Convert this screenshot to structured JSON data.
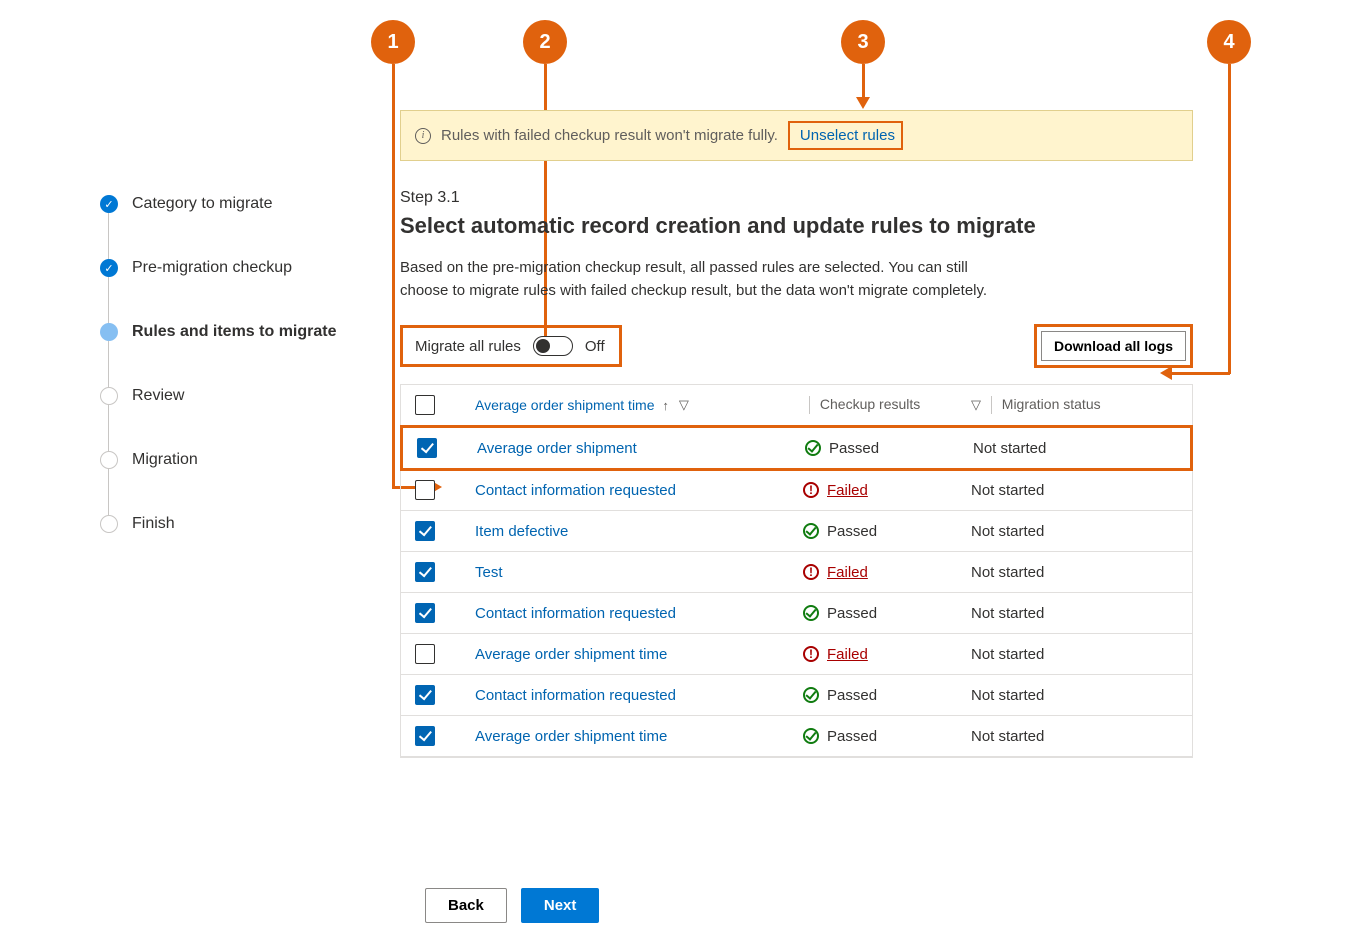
{
  "callouts": [
    "1",
    "2",
    "3",
    "4"
  ],
  "sidebar": {
    "items": [
      {
        "label": "Category to migrate",
        "state": "done"
      },
      {
        "label": "Pre-migration checkup",
        "state": "done"
      },
      {
        "label": "Rules and items to migrate",
        "state": "current"
      },
      {
        "label": "Review",
        "state": "pending"
      },
      {
        "label": "Migration",
        "state": "pending"
      },
      {
        "label": "Finish",
        "state": "pending"
      }
    ]
  },
  "banner": {
    "text": "Rules with failed checkup result won't migrate fully.",
    "link": "Unselect rules"
  },
  "step": {
    "kicker": "Step 3.1",
    "title": "Select automatic record creation and update rules to migrate",
    "desc": "Based on the pre-migration checkup result, all passed rules are selected. You can still choose to migrate rules with failed checkup result, but the data won't migrate completely."
  },
  "toggle": {
    "label": "Migrate all rules",
    "state": "Off"
  },
  "download": {
    "label": "Download all logs"
  },
  "grid": {
    "header_name": "Average order shipment time",
    "col_checkup": "Checkup results",
    "col_migration": "Migration status",
    "rows": [
      {
        "checked": true,
        "name": "Average order shipment",
        "checkup": "Passed",
        "migration": "Not started",
        "highlight": true
      },
      {
        "checked": false,
        "name": "Contact information requested",
        "checkup": "Failed",
        "migration": "Not started"
      },
      {
        "checked": true,
        "name": "Item defective",
        "checkup": "Passed",
        "migration": "Not started"
      },
      {
        "checked": true,
        "name": "Test",
        "checkup": "Failed",
        "migration": "Not started"
      },
      {
        "checked": true,
        "name": "Contact information requested",
        "checkup": "Passed",
        "migration": "Not started"
      },
      {
        "checked": false,
        "name": "Average order shipment time",
        "checkup": "Failed",
        "migration": "Not started"
      },
      {
        "checked": true,
        "name": "Contact information requested",
        "checkup": "Passed",
        "migration": "Not started"
      },
      {
        "checked": true,
        "name": "Average order shipment time",
        "checkup": "Passed",
        "migration": "Not started"
      }
    ]
  },
  "footer": {
    "back": "Back",
    "next": "Next"
  }
}
